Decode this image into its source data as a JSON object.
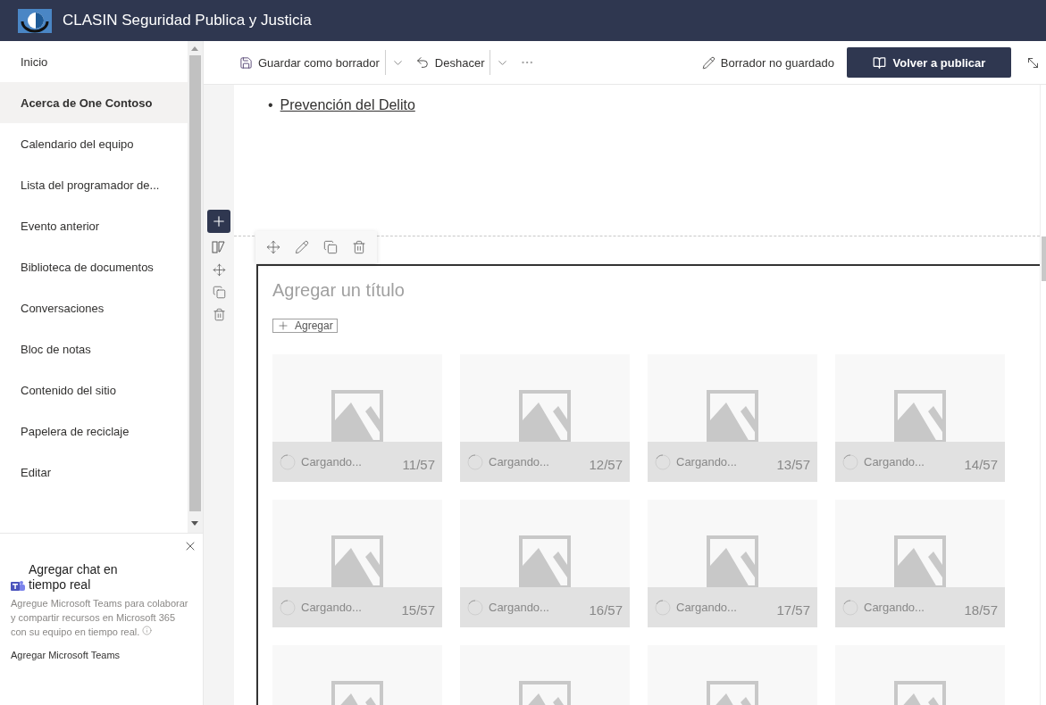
{
  "header": {
    "title": "CLASIN Seguridad Publica y Justicia"
  },
  "nav": {
    "items": [
      {
        "label": "Inicio",
        "selected": false
      },
      {
        "label": "Acerca de One Contoso",
        "selected": true
      },
      {
        "label": "Calendario del equipo",
        "selected": false
      },
      {
        "label": "Lista del programador de...",
        "selected": false
      },
      {
        "label": "Evento anterior",
        "selected": false
      },
      {
        "label": "Biblioteca de documentos",
        "selected": false
      },
      {
        "label": "Conversaciones",
        "selected": false
      },
      {
        "label": "Bloc de notas",
        "selected": false
      },
      {
        "label": "Contenido del sitio",
        "selected": false
      },
      {
        "label": "Papelera de reciclaje",
        "selected": false
      },
      {
        "label": "Editar",
        "selected": false
      }
    ]
  },
  "teams_panel": {
    "title": "Agregar chat en tiempo real",
    "description": "Agregue Microsoft Teams para colaborar y compartir recursos en Microsoft 365 con su equipo en tiempo real.",
    "link": "Agregar Microsoft Teams"
  },
  "toolbar": {
    "save": "Guardar como borrador",
    "undo": "Deshacer",
    "status": "Borrador no guardado",
    "publish": "Volver a publicar"
  },
  "content": {
    "bullets": [
      {
        "marker": "•",
        "text": "Prevención del Delito"
      }
    ],
    "gallery": {
      "title_placeholder": "Agregar un título",
      "add_button": "Agregar",
      "tiles": [
        {
          "kind": "loading",
          "status": "Cargando...",
          "position": "11/57"
        },
        {
          "kind": "loading",
          "status": "Cargando...",
          "position": "12/57"
        },
        {
          "kind": "loading",
          "status": "Cargando...",
          "position": "13/57"
        },
        {
          "kind": "loading",
          "status": "Cargando...",
          "position": "14/57"
        },
        {
          "kind": "loading",
          "status": "Cargando...",
          "position": "15/57"
        },
        {
          "kind": "loading",
          "status": "Cargando...",
          "position": "16/57"
        },
        {
          "kind": "loading",
          "status": "Cargando...",
          "position": "17/57"
        },
        {
          "kind": "loading",
          "status": "Cargando...",
          "position": "18/57"
        },
        {
          "kind": "image"
        },
        {
          "kind": "image"
        },
        {
          "kind": "image"
        },
        {
          "kind": "image"
        }
      ]
    }
  }
}
